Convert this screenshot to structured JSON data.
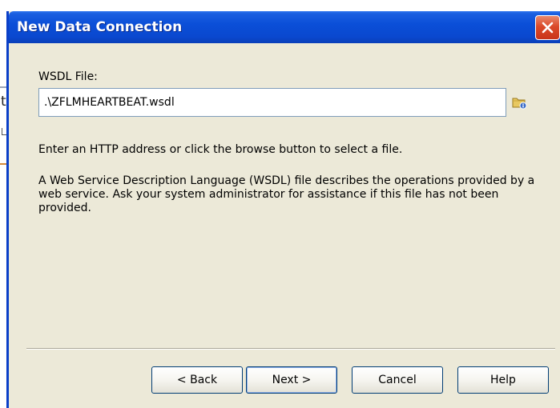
{
  "dialog": {
    "title": "New Data Connection"
  },
  "form": {
    "wsdl_label": "WSDL File:",
    "wsdl_value": ".\\ZFLMHEARTBEAT.wsdl",
    "info_line1": "Enter an HTTP address or click the browse button to select a file.",
    "info_line2": "A Web Service Description Language (WSDL) file describes the operations provided by a web service.  Ask your system administrator for assistance if this file has not been provided."
  },
  "buttons": {
    "back": "< Back",
    "next": "Next >",
    "cancel": "Cancel",
    "help": "Help"
  },
  "background": {
    "left_letter": "t"
  },
  "icons": {
    "close": "close-icon",
    "browse": "folder-browse-icon"
  },
  "colors": {
    "titlebar": "#0a4fd8",
    "dialog_bg": "#ece9d8",
    "close_button": "#db4a2a"
  }
}
